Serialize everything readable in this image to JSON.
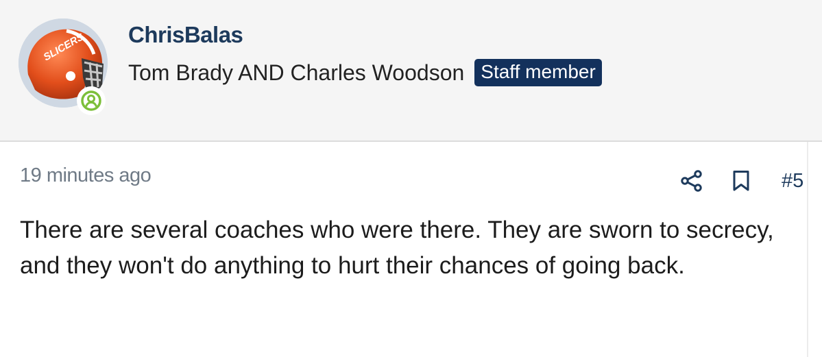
{
  "user": {
    "name": "ChrisBalas",
    "title": "Tom Brady AND Charles Woodson",
    "badge": "Staff member",
    "avatar_text": "SLICERS",
    "status_icon": "online-user-icon"
  },
  "post": {
    "timestamp": "19 minutes ago",
    "number": "#5",
    "message": "There are several coaches who were there. They are sworn to secrecy, and they won't do anything to hurt their chances of going back."
  },
  "actions": {
    "share_icon": "share-icon",
    "bookmark_icon": "bookmark-icon"
  },
  "colors": {
    "header_bg": "#f5f5f5",
    "username": "#1d3a5c",
    "badge_bg": "#13315c",
    "timestamp": "#6f7a86",
    "online": "#7cbf3a",
    "helmet": "#e24e1b"
  }
}
